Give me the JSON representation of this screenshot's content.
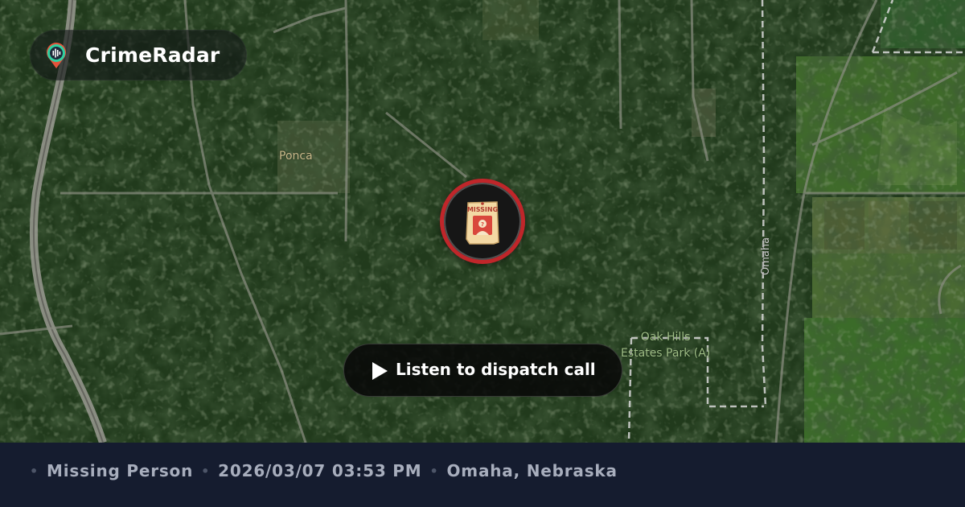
{
  "brand": {
    "name": "CrimeRadar",
    "logo_icon": "radar-pin-icon"
  },
  "map": {
    "labels": {
      "ponca": "Ponca",
      "park_line1": "Oak Hills",
      "park_line2": "Estates Park (A)",
      "road": "Omaha"
    },
    "marker": {
      "icon": "missing-poster-icon",
      "icon_text": "MISSING",
      "ring_color": "#c0262a"
    }
  },
  "play_button": {
    "icon": "play-icon",
    "label": "Listen to dispatch call"
  },
  "footer": {
    "incident_type": "Missing Person",
    "datetime": "2026/03/07 03:53 PM",
    "location": "Omaha, Nebraska"
  }
}
